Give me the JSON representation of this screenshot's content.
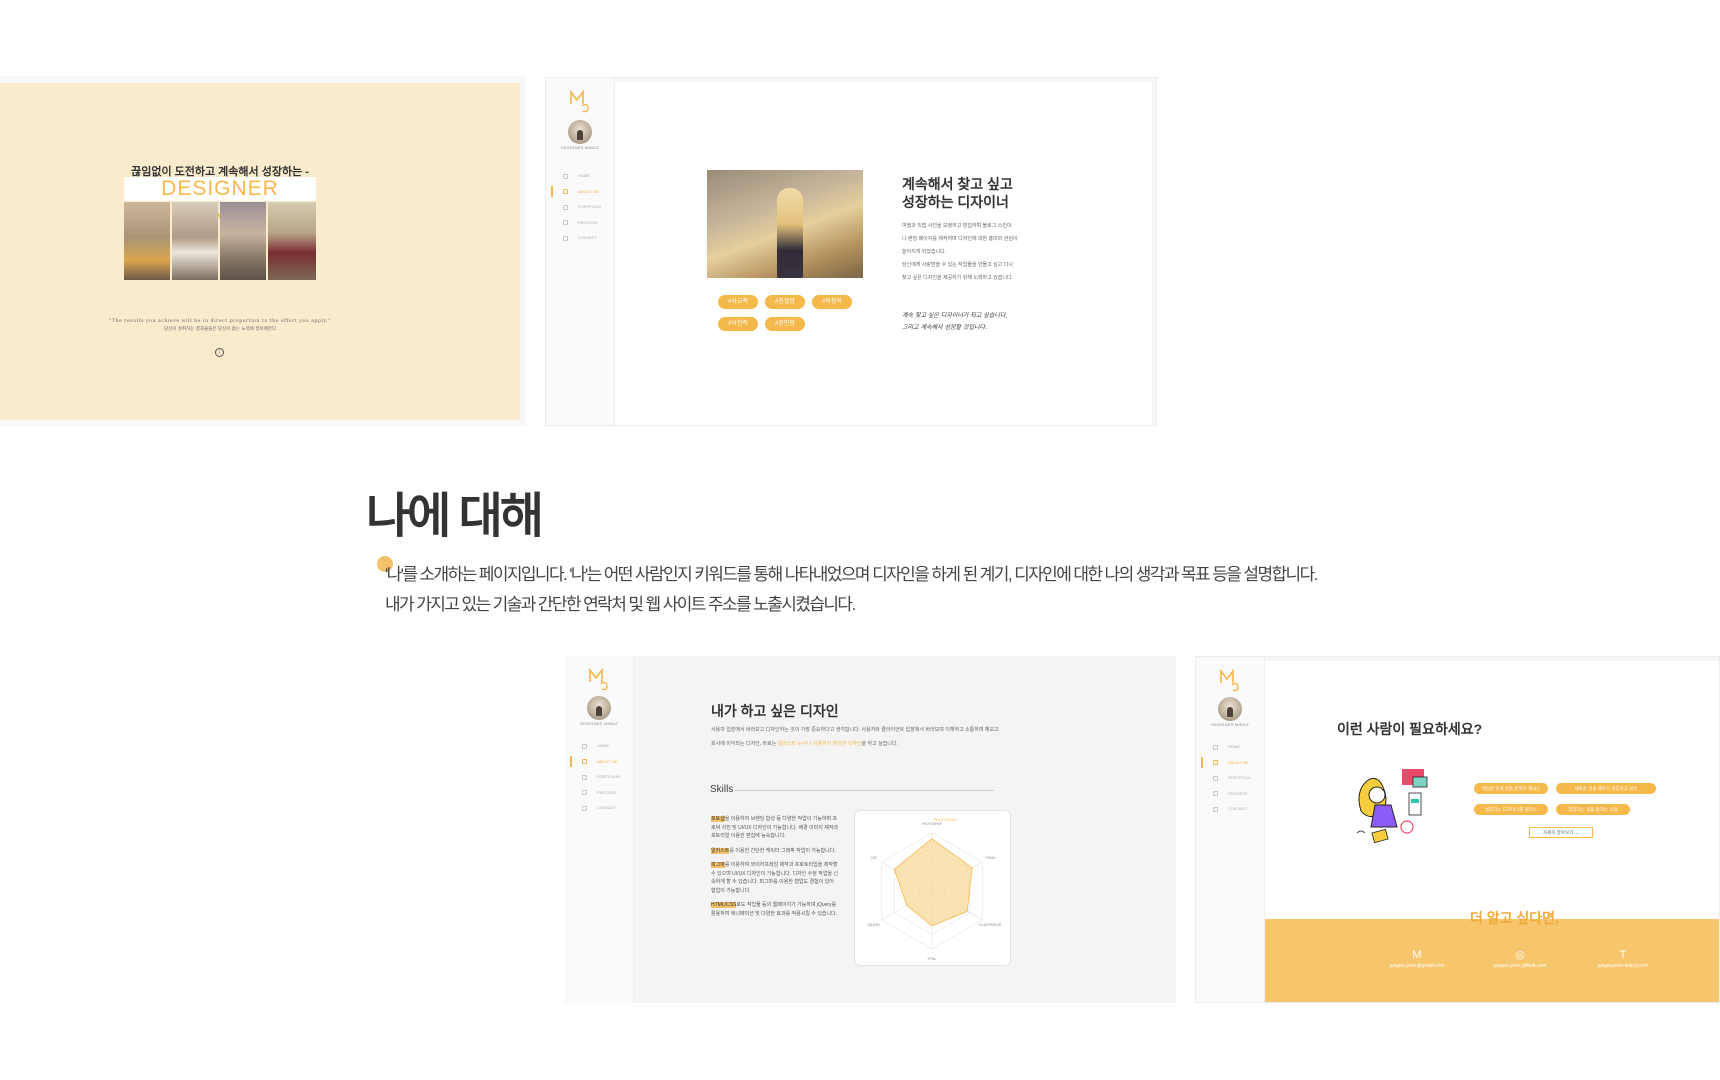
{
  "cover": {
    "headline": "끊임없이 도전하고 계속해서 성장하는 -",
    "brand": "DESIGNER MINGZ",
    "quote_en": "\"The results you achieve will be in direct proportion to the effort you apply.\"",
    "quote_ko": "당신이 성취하는 결과물들은 당신이 쏟는 노력에 정비례한다",
    "scroll_icon": "arrow-down-circle-icon"
  },
  "sidebar": {
    "brand_label": "DESIGNER MINGZ",
    "items": [
      {
        "label": "HOME",
        "icon": "home-icon"
      },
      {
        "label": "ABOUT ME",
        "icon": "user-icon"
      },
      {
        "label": "PORTFOLIO",
        "icon": "chat-icon"
      },
      {
        "label": "PROCESS",
        "icon": "grid-icon"
      },
      {
        "label": "CONTACT",
        "icon": "phone-icon"
      }
    ]
  },
  "about_screen": {
    "title_line1": "계속해서 찾고 싶고",
    "title_line2": "성장하는 디자이너",
    "paragraphs": [
      "여행과 직접 사진을 보정하고 편집하며 블로그 스킨이",
      "나 랜딩 페이지를 제작하며 디자인에 대한 흥미와 관심이",
      "높아지게 되었습니다.",
      "당신에게 사랑받을 수 있는 작업물을 만들고 싶고 다시",
      "찾고 싶은 디자인을 제공하기 위해 노력하고 있습니다."
    ],
    "signature_line1": "계속 찾고 싶은 디자이너가 되고 싶습니다,",
    "signature_line2": "그리고 계속해서 성장할 것입니다.",
    "keywords": [
      "#사교적",
      "#친절함",
      "#독창적",
      "#낙천적",
      "#완만함"
    ]
  },
  "section": {
    "title": "나에 대해",
    "desc_line1": "'나'를 소개하는 페이지입니다. '나'는 어떤 사람인지 키워드를 통해 나타내었으며 디자인을 하게 된 계기, 디자인에 대한 나의 생각과 목표 등을 설명합니다.",
    "desc_line2": "내가 가지고 있는 기술과 간단한 연락처 및 웹 사이트 주소를 노출시켰습니다."
  },
  "design_screen": {
    "title": "내가 하고 싶은 디자인",
    "desc1": "사용자 입장에서 바라보고 디자인하는 것이 가장 중요하다고 생각합니다. 사용자와 클라이언트 입장에서 바라보며 이해하고 소통하며 해보고",
    "desc2_pre": "회사에 이익되는 디자인, 바로는 ",
    "desc2_highlight": "일러스트 누구나 이용하기 편리한 디자인",
    "desc2_post": "을 하고 싶습니다.",
    "skills_title": "Skills",
    "skills": [
      {
        "name": "포토샵",
        "text": "을 이용하여 브랜딩 합성 등 다양한 작업이 가능하며 프로덕 사진 및 UI/UX 디자인이 가능합니다. 배경 이미지 제작과 포토리얼 이용한 편집에 능숙합니다."
      },
      {
        "name": "일러스트",
        "text": "를 이용한 간단한 캐릭터 그래픽 작업이 가능합니다."
      },
      {
        "name": "피그마",
        "text": "를 이용하여 와이어프레임 제작과 프로토타입을 제작할 수 있으며 UI/UX 디자인이 가능합니다. 디자인 수정 작업을 신속하게 할 수 있습니다. 피그마를 이용한 협업도 경험이 있어 협업이 가능합니다."
      },
      {
        "name": "HTML/CSS",
        "text": "로도 작업물 등의 웹페이지가 가능하며 jQuery를 활용하여 애니메이션 및 다양한 효과를 적용시킬 수 있습니다."
      }
    ],
    "radar": {
      "top_label": "PHOTOSHOP",
      "axes": [
        "PHOTOSHOP",
        "FIGMA",
        "ILLUSTRATOR",
        "HTML",
        "JQUERY",
        "CSS"
      ],
      "values": [
        90,
        80,
        70,
        60,
        50,
        75
      ]
    }
  },
  "contact_screen": {
    "title": "이런 사람이 필요하세요?",
    "tags": [
      "책임감 있게 일을 끝까지 해내는",
      "새로운 것을 배우고 성장하고 싶은",
      "성장하는 디자이너를 원하는",
      "협업하는 일을 잘하는 사람"
    ],
    "more_button": "자세히 알아보기 →",
    "footer_title": "더 알고 싶다면,",
    "contacts": [
      {
        "icon": "mail-icon",
        "glyph": "M",
        "text": "jungsu.yoon@gmail.com"
      },
      {
        "icon": "github-icon",
        "glyph": "◎",
        "text": "jungsu-yoon.github.com"
      },
      {
        "icon": "tistory-icon",
        "glyph": "T",
        "text": "jungsuyoon.tistory.com"
      }
    ]
  },
  "colors": {
    "accent": "#f4b94a",
    "cover_bg": "#faebcc",
    "footer_bg": "#f6c56c"
  }
}
